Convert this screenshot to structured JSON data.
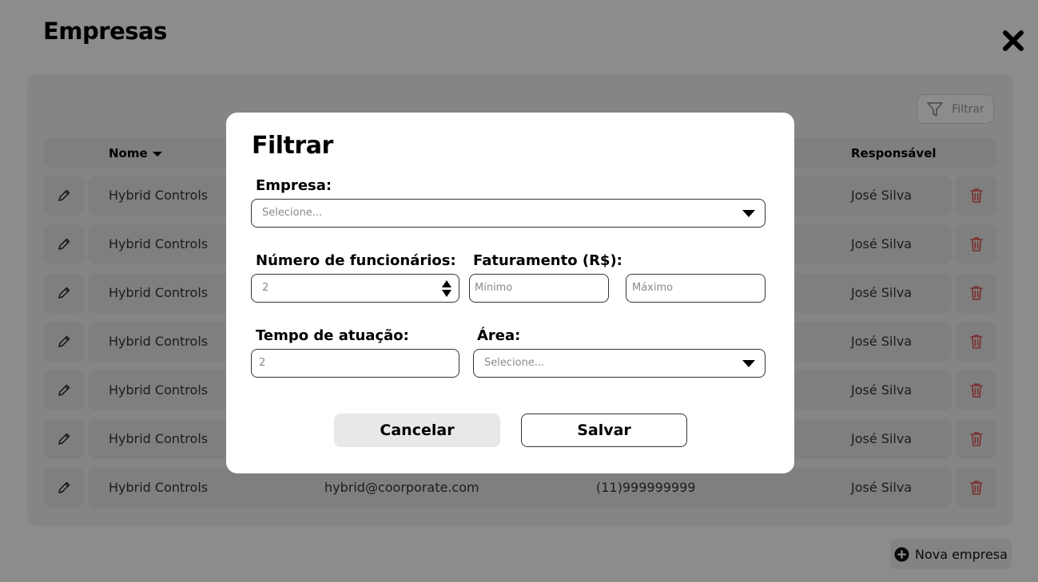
{
  "page": {
    "title": "Empresas"
  },
  "toolbar": {
    "filter_label": "Filtrar"
  },
  "table": {
    "columns": {
      "name": "Nome",
      "responsible": "Responsável"
    },
    "rows": [
      {
        "name": "Hybrid Controls",
        "email": "",
        "phone": "",
        "responsible": "José Silva"
      },
      {
        "name": "Hybrid Controls",
        "email": "",
        "phone": "",
        "responsible": "José Silva"
      },
      {
        "name": "Hybrid Controls",
        "email": "",
        "phone": "",
        "responsible": "José Silva"
      },
      {
        "name": "Hybrid Controls",
        "email": "",
        "phone": "",
        "responsible": "José Silva"
      },
      {
        "name": "Hybrid Controls",
        "email": "",
        "phone": "",
        "responsible": "José Silva"
      },
      {
        "name": "Hybrid Controls",
        "email": "",
        "phone": "",
        "responsible": "José Silva"
      },
      {
        "name": "Hybrid Controls",
        "email": "hybrid@coorporate.com",
        "phone": "(11)999999999",
        "responsible": "José Silva"
      }
    ]
  },
  "footer": {
    "new_company_label": "Nova empresa"
  },
  "modal": {
    "title": "Filtrar",
    "company": {
      "label": "Empresa:",
      "placeholder": "Selecione..."
    },
    "employees": {
      "label": "Número de funcionários:",
      "value": "2"
    },
    "revenue": {
      "label": "Faturamento (R$):",
      "min_placeholder": "Mínimo",
      "max_placeholder": "Máximo"
    },
    "tenure": {
      "label": "Tempo de atuação:",
      "value": "2"
    },
    "area": {
      "label": "Área:",
      "placeholder": "Selecione..."
    },
    "cancel_label": "Cancelar",
    "save_label": "Salvar"
  },
  "colors": {
    "overlay": "#000000",
    "card_bg": "#f3f3f3",
    "row_bg": "#e7e7e7",
    "delete_icon": "#e05252",
    "cancel_bg": "#e8e8e8"
  },
  "icons": {
    "close": "close-icon",
    "filter": "filter-funnel-icon",
    "edit": "pencil-icon",
    "delete": "trash-icon",
    "add": "plus-circle-icon"
  }
}
